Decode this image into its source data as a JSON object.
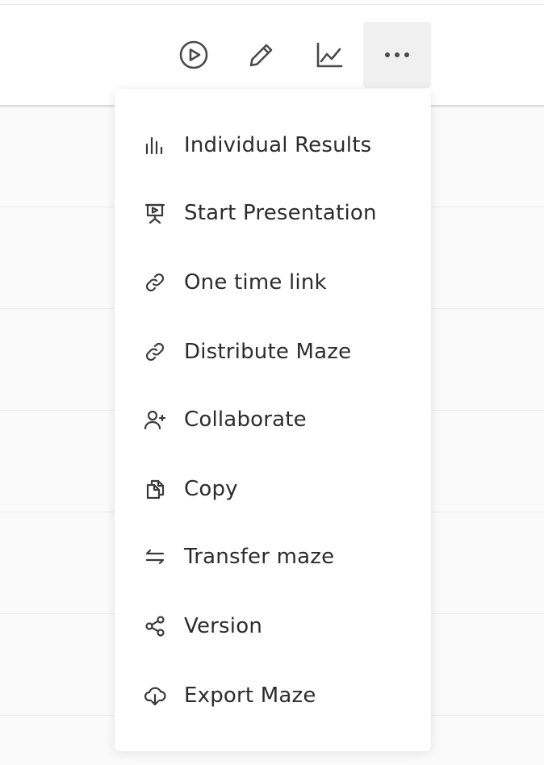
{
  "toolbar": {
    "buttons": [
      {
        "name": "play-button",
        "icon": "play-circle-icon"
      },
      {
        "name": "edit-button",
        "icon": "pencil-icon"
      },
      {
        "name": "analytics-button",
        "icon": "line-chart-icon"
      },
      {
        "name": "more-options-button",
        "icon": "more-horizontal-icon",
        "active": true
      }
    ]
  },
  "menu": {
    "items": [
      {
        "label": "Individual Results",
        "icon": "bar-chart-icon"
      },
      {
        "label": "Start Presentation",
        "icon": "presentation-icon"
      },
      {
        "label": "One time link",
        "icon": "link-icon"
      },
      {
        "label": "Distribute Maze",
        "icon": "link-icon"
      },
      {
        "label": "Collaborate",
        "icon": "user-plus-icon"
      },
      {
        "label": "Copy",
        "icon": "copy-icon"
      },
      {
        "label": "Transfer maze",
        "icon": "transfer-icon"
      },
      {
        "label": "Version",
        "icon": "share-nodes-icon"
      },
      {
        "label": "Export Maze",
        "icon": "cloud-download-icon"
      }
    ]
  },
  "colors": {
    "icon": "#3a3a3a",
    "text": "#2c2c2c",
    "active_button_bg": "#f0f0f0",
    "background": "#fafafa"
  }
}
